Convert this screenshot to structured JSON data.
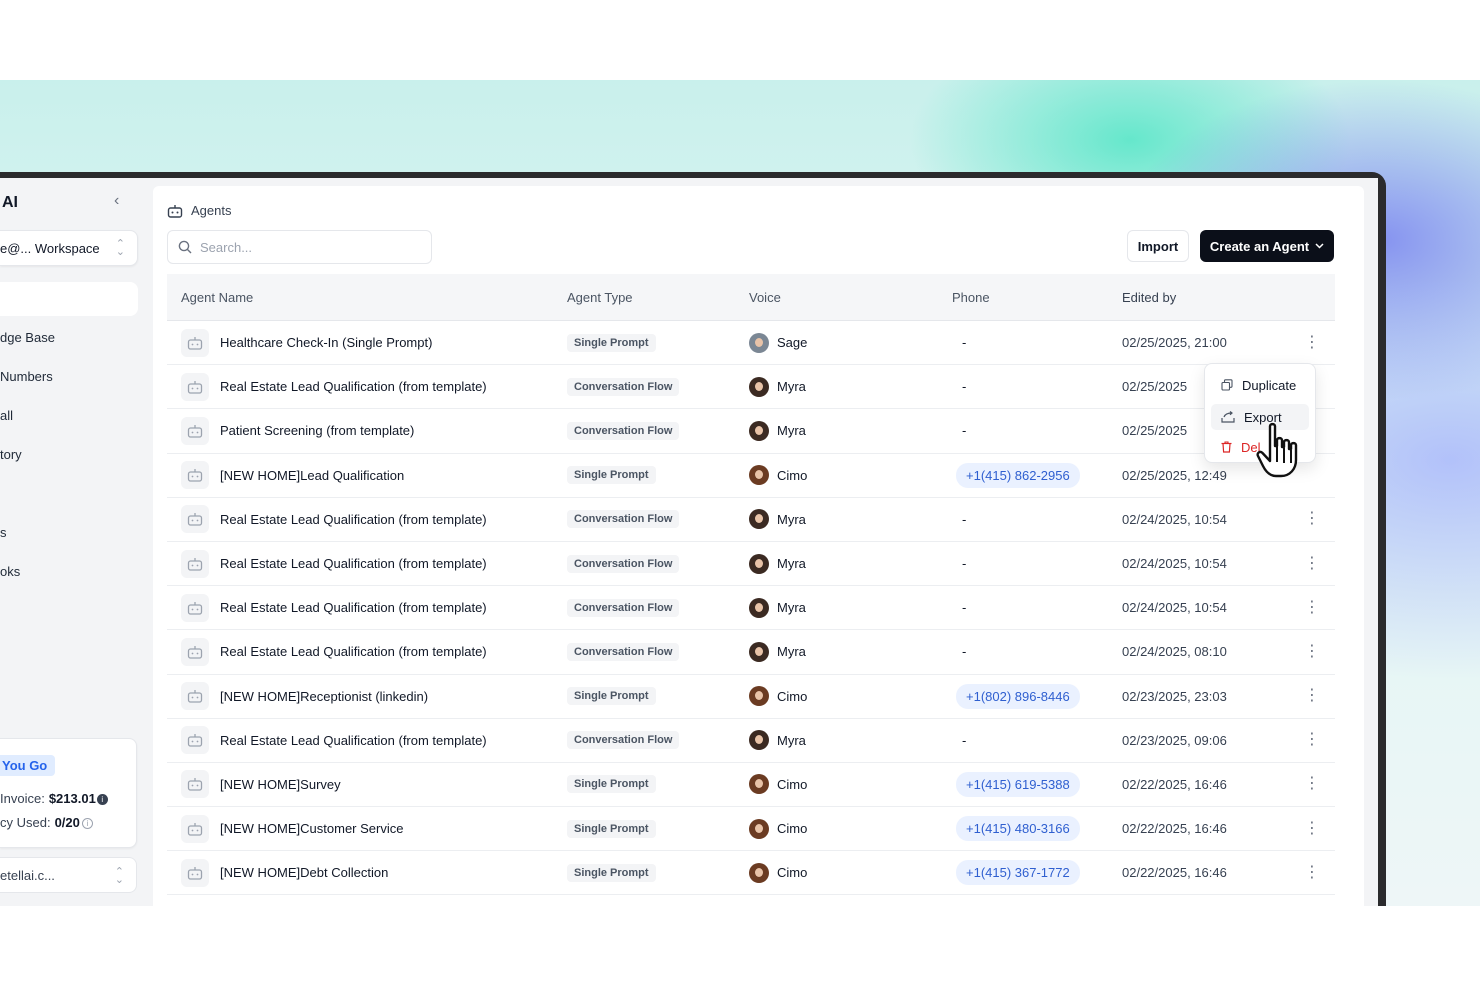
{
  "sidebar": {
    "brand": "AI",
    "workspace": "e@... Workspace",
    "items": [
      "dge Base",
      "Numbers",
      "all",
      "tory",
      "s",
      "oks"
    ],
    "billing": {
      "plan": "You Go",
      "invoice_label": "Invoice:",
      "invoice_value": "$213.01",
      "concurrency_label": "cy Used:",
      "concurrency_value": "0/20"
    },
    "account": "etellai.c..."
  },
  "header": {
    "breadcrumb": "Agents",
    "search_placeholder": "Search...",
    "import_label": "Import",
    "create_label": "Create an Agent"
  },
  "table": {
    "columns": [
      "Agent Name",
      "Agent Type",
      "Voice",
      "Phone",
      "Edited by"
    ],
    "rows": [
      {
        "name": "Healthcare Check-In (Single Prompt)",
        "type": "Single Prompt",
        "voice": "Sage",
        "phone": "-",
        "edited": "02/25/2025, 21:00"
      },
      {
        "name": "Real Estate Lead Qualification (from template)",
        "type": "Conversation Flow",
        "voice": "Myra",
        "phone": "-",
        "edited": "02/25/2025"
      },
      {
        "name": "Patient Screening (from template)",
        "type": "Conversation Flow",
        "voice": "Myra",
        "phone": "-",
        "edited": "02/25/2025"
      },
      {
        "name": "[NEW HOME]Lead Qualification",
        "type": "Single Prompt",
        "voice": "Cimo",
        "phone": "+1(415) 862-2956",
        "edited": "02/25/2025, 12:49"
      },
      {
        "name": "Real Estate Lead Qualification (from template)",
        "type": "Conversation Flow",
        "voice": "Myra",
        "phone": "-",
        "edited": "02/24/2025, 10:54"
      },
      {
        "name": "Real Estate Lead Qualification (from template)",
        "type": "Conversation Flow",
        "voice": "Myra",
        "phone": "-",
        "edited": "02/24/2025, 10:54"
      },
      {
        "name": "Real Estate Lead Qualification (from template)",
        "type": "Conversation Flow",
        "voice": "Myra",
        "phone": "-",
        "edited": "02/24/2025, 10:54"
      },
      {
        "name": "Real Estate Lead Qualification (from template)",
        "type": "Conversation Flow",
        "voice": "Myra",
        "phone": "-",
        "edited": "02/24/2025, 08:10"
      },
      {
        "name": "[NEW HOME]Receptionist (linkedin)",
        "type": "Single Prompt",
        "voice": "Cimo",
        "phone": "+1(802) 896-8446",
        "edited": "02/23/2025, 23:03"
      },
      {
        "name": "Real Estate Lead Qualification (from template)",
        "type": "Conversation Flow",
        "voice": "Myra",
        "phone": "-",
        "edited": "02/23/2025, 09:06"
      },
      {
        "name": "[NEW HOME]Survey",
        "type": "Single Prompt",
        "voice": "Cimo",
        "phone": "+1(415) 619-5388",
        "edited": "02/22/2025, 16:46"
      },
      {
        "name": "[NEW HOME]Customer Service",
        "type": "Single Prompt",
        "voice": "Cimo",
        "phone": "+1(415) 480-3166",
        "edited": "02/22/2025, 16:46"
      },
      {
        "name": "[NEW HOME]Debt Collection",
        "type": "Single Prompt",
        "voice": "Cimo",
        "phone": "+1(415) 367-1772",
        "edited": "02/22/2025, 16:46"
      }
    ]
  },
  "dropdown": {
    "duplicate": "Duplicate",
    "export": "Export",
    "delete": "Del"
  }
}
